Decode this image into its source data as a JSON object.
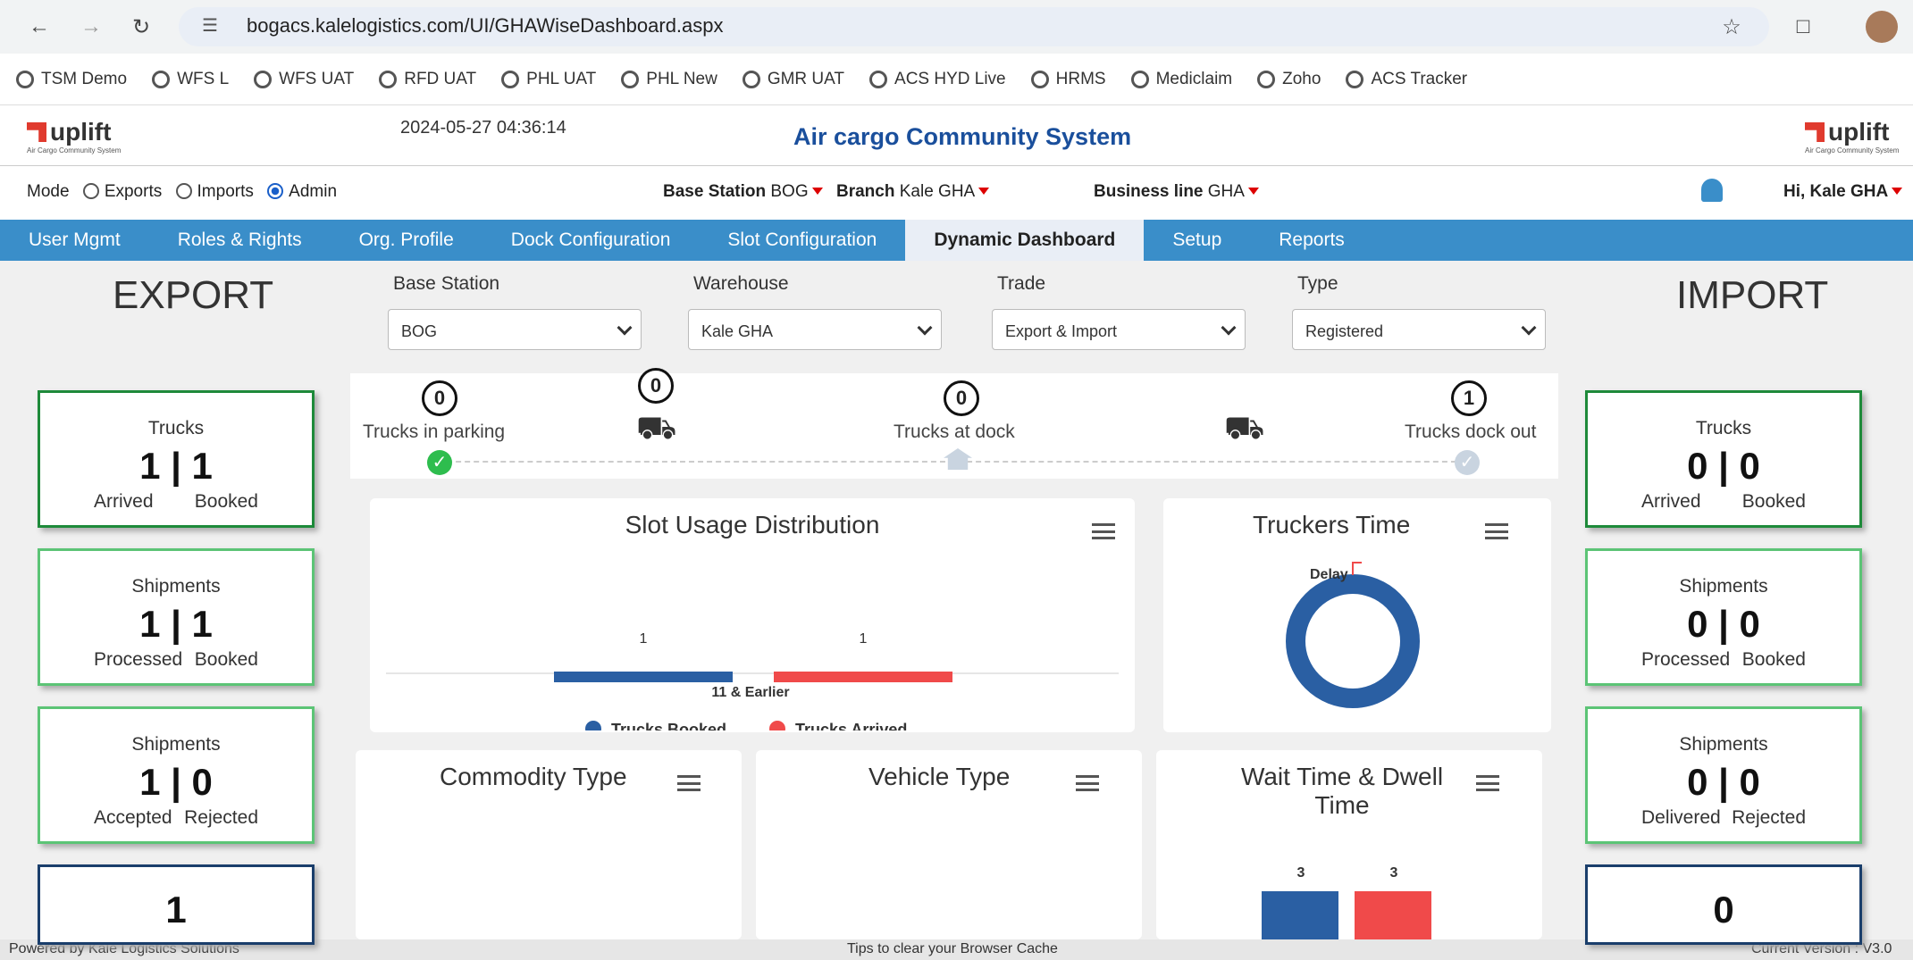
{
  "browser": {
    "url": "bogacs.kalelogistics.com/UI/GHAWiseDashboard.aspx",
    "bookmarks": [
      "TSM Demo",
      "WFS L",
      "WFS UAT",
      "RFD UAT",
      "PHL UAT",
      "PHL New",
      "GMR UAT",
      "ACS HYD Live",
      "HRMS",
      "Mediclaim",
      "Zoho",
      "ACS Tracker"
    ]
  },
  "header": {
    "logo_text": "uplift",
    "logo_sub": "Air Cargo Community System",
    "datetime": "2024-05-27 04:36:14",
    "title": "Air cargo Community System"
  },
  "subbar": {
    "mode_label": "Mode",
    "mode_exports": "Exports",
    "mode_imports": "Imports",
    "mode_admin": "Admin",
    "base_station_label": "Base Station",
    "base_station_value": "BOG",
    "branch_label": "Branch",
    "branch_value": "Kale GHA",
    "business_line_label": "Business line",
    "business_line_value": "GHA",
    "greeting": "Hi, Kale GHA"
  },
  "menu": [
    "User Mgmt",
    "Roles & Rights",
    "Org. Profile",
    "Dock Configuration",
    "Slot Configuration",
    "Dynamic Dashboard",
    "Setup",
    "Reports"
  ],
  "export": {
    "title": "EXPORT",
    "cards": [
      {
        "title": "Trucks",
        "value": "1 | 1",
        "l1": "Arrived",
        "l2": "Booked"
      },
      {
        "title": "Shipments",
        "value": "1 | 1",
        "l1": "Processed",
        "l2": "Booked"
      },
      {
        "title": "Shipments",
        "value": "1 | 0",
        "l1": "Accepted",
        "l2": "Rejected"
      },
      {
        "value": "1"
      }
    ]
  },
  "import": {
    "title": "IMPORT",
    "cards": [
      {
        "title": "Trucks",
        "value": "0 | 0",
        "l1": "Arrived",
        "l2": "Booked"
      },
      {
        "title": "Shipments",
        "value": "0 | 0",
        "l1": "Processed",
        "l2": "Booked"
      },
      {
        "title": "Shipments",
        "value": "0 | 0",
        "l1": "Delivered",
        "l2": "Rejected"
      },
      {
        "value": "0"
      }
    ]
  },
  "filters": {
    "base_station": {
      "label": "Base Station",
      "value": "BOG"
    },
    "warehouse": {
      "label": "Warehouse",
      "value": "Kale GHA"
    },
    "trade": {
      "label": "Trade",
      "value": "Export & Import"
    },
    "type": {
      "label": "Type",
      "value": "Registered"
    }
  },
  "flow": {
    "parking": {
      "count": "0",
      "label": "Trucks in parking"
    },
    "moving": {
      "count": "0"
    },
    "dock": {
      "count": "0",
      "label": "Trucks at dock"
    },
    "dockout": {
      "count": "1",
      "label": "Trucks dock out"
    }
  },
  "panels": {
    "slot_usage": "Slot Usage Distribution",
    "truckers_time": "Truckers Time",
    "commodity": "Commodity Type",
    "vehicle": "Vehicle Type",
    "wait_time": "Wait Time & Dwell Time"
  },
  "chart_data": [
    {
      "type": "bar",
      "title": "Slot Usage Distribution",
      "categories": [
        "11 & Earlier"
      ],
      "series": [
        {
          "name": "Trucks Booked",
          "values": [
            1
          ],
          "color": "#2a5fa3"
        },
        {
          "name": "Trucks Arrived",
          "values": [
            1
          ],
          "color": "#f04a4a"
        }
      ],
      "legend": "bottom"
    },
    {
      "type": "pie",
      "title": "Truckers Time",
      "labels": [
        "Delay"
      ],
      "values": [
        1
      ],
      "colors": [
        "#2a5fa3"
      ]
    },
    {
      "type": "bar",
      "title": "Wait Time & Dwell Time",
      "values": [
        3,
        3
      ],
      "colors": [
        "#2a5fa3",
        "#f04a4a"
      ]
    }
  ],
  "footer": {
    "left": "Powered by Kale Logistics Solutions",
    "center": "Tips to clear your Browser Cache",
    "right": "Current Version : V3.0"
  },
  "colors": {
    "menu": "#3a8ec9",
    "booked": "#2a5fa3",
    "arrived": "#f04a4a",
    "card_green": "#1e8a3a"
  }
}
